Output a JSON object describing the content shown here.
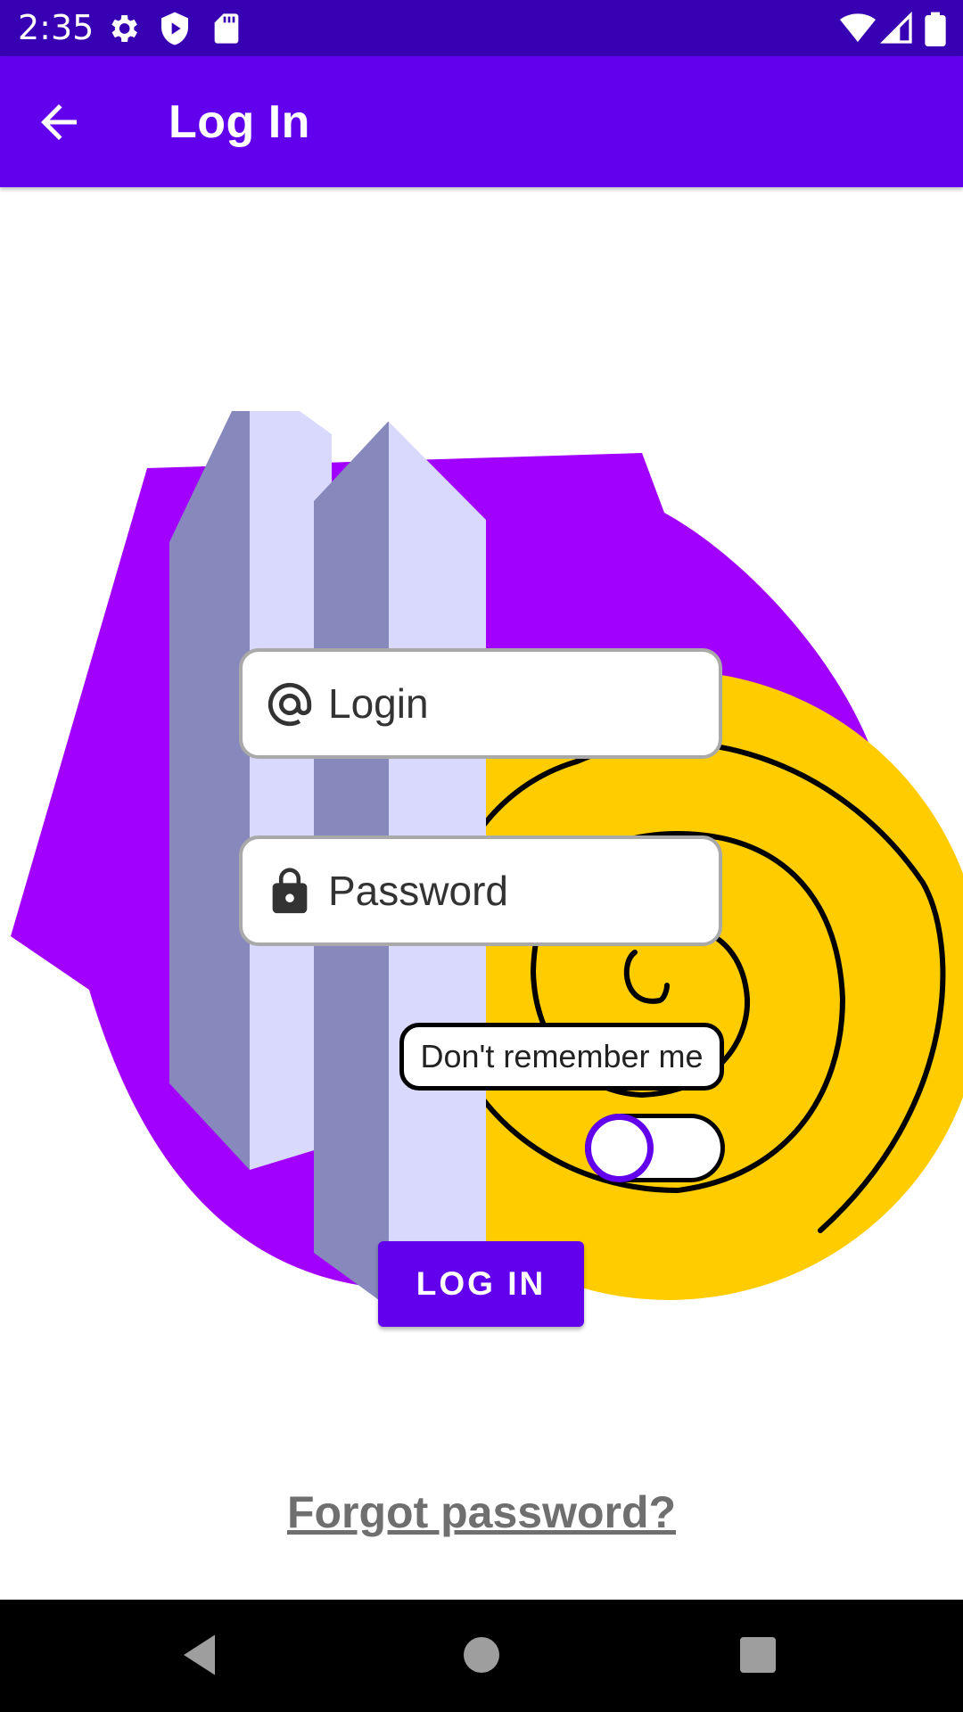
{
  "status_bar": {
    "time": "2:35",
    "icons": [
      "settings-icon",
      "shield-play-icon",
      "sd-card-icon",
      "wifi-icon",
      "signal-icon",
      "battery-icon"
    ],
    "background": "#3700b3"
  },
  "app_bar": {
    "title": "Log In",
    "back_icon": "arrow-back-icon",
    "background": "#6200ee"
  },
  "form": {
    "login_field": {
      "placeholder": "Login",
      "value": "",
      "icon": "at-sign-icon"
    },
    "password_field": {
      "placeholder": "Password",
      "value": "",
      "icon": "lock-icon"
    },
    "remember_label": "Don't remember me",
    "remember_switch": {
      "checked": false
    },
    "login_button_label": "LOG IN",
    "forgot_password_label": "Forgot password?"
  },
  "colors": {
    "accent": "#6200ee",
    "illustration_purple": "#a100ff",
    "illustration_yellow": "#ffcc00",
    "tower_dark": "#8789bd",
    "tower_light": "#d9d9fd"
  },
  "nav_bar": {
    "icons": [
      "back-triangle-icon",
      "home-circle-icon",
      "recents-square-icon"
    ]
  }
}
